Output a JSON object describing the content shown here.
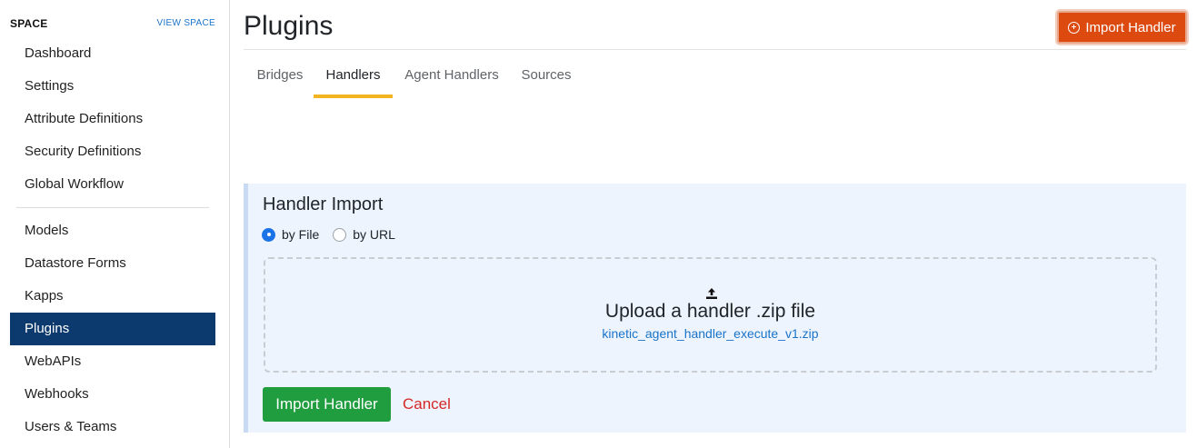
{
  "sidebar": {
    "title": "SPACE",
    "view_link": "VIEW SPACE",
    "items": [
      {
        "label": "Dashboard"
      },
      {
        "label": "Settings"
      },
      {
        "label": "Attribute Definitions"
      },
      {
        "label": "Security Definitions"
      },
      {
        "label": "Global Workflow"
      },
      {
        "label": "Models"
      },
      {
        "label": "Datastore Forms"
      },
      {
        "label": "Kapps"
      },
      {
        "label": "Plugins",
        "active": true
      },
      {
        "label": "WebAPIs"
      },
      {
        "label": "Webhooks"
      },
      {
        "label": "Users & Teams"
      }
    ]
  },
  "header": {
    "title": "Plugins",
    "import_button": {
      "label": "Import Handler",
      "icon": "plus-circle-icon"
    }
  },
  "tabs": [
    {
      "label": "Bridges"
    },
    {
      "label": "Handlers",
      "active": true
    },
    {
      "label": "Agent Handlers"
    },
    {
      "label": "Sources"
    }
  ],
  "import_panel": {
    "title": "Handler Import",
    "options": [
      {
        "label": "by File",
        "checked": true
      },
      {
        "label": "by URL",
        "checked": false
      }
    ],
    "dropzone": {
      "icon": "upload-icon",
      "title": "Upload a handler .zip file",
      "filename": "kinetic_agent_handler_execute_v1.zip"
    },
    "submit_label": "Import Handler",
    "cancel_label": "Cancel"
  },
  "colors": {
    "sidebar_active": "#0d3a6e",
    "primary_orange": "#dc4a10",
    "success_green": "#1f9d3f",
    "tab_underline": "#f2b521",
    "link_blue": "#1a73c8",
    "cancel_red": "#d62828",
    "panel_bg": "#edf4fd"
  }
}
